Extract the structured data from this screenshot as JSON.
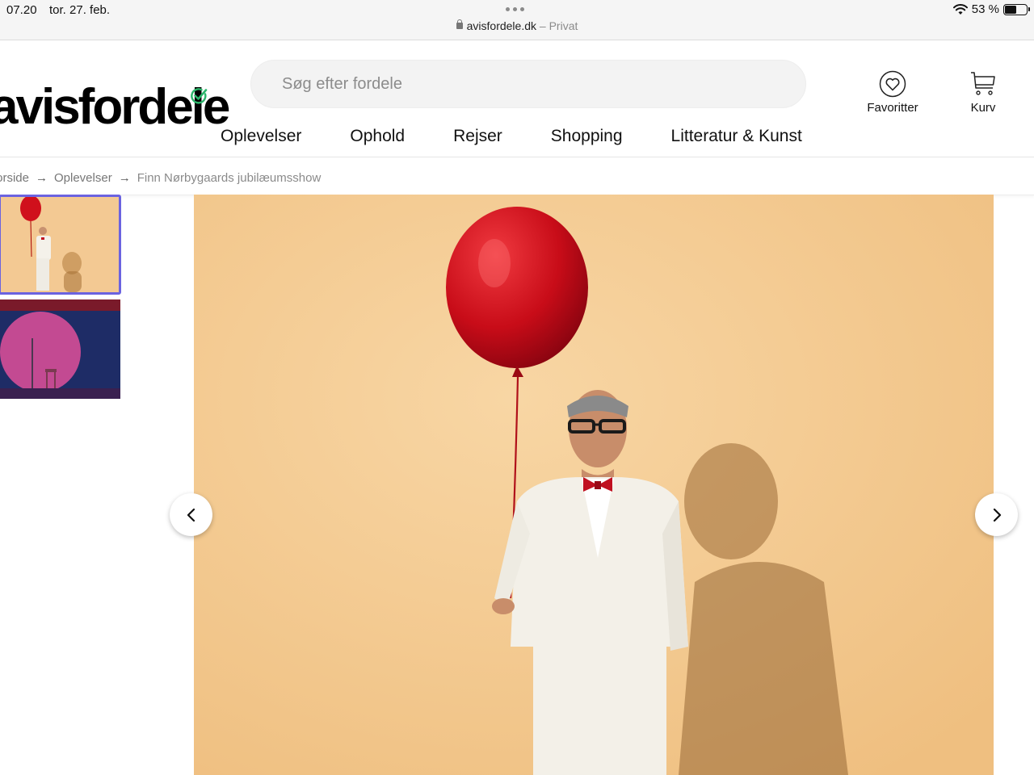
{
  "status_bar": {
    "time": "07.20",
    "date": "tor. 27. feb.",
    "battery": "53 %",
    "battery_level": 0.53
  },
  "browser": {
    "domain": "avisfordele.dk",
    "mode": "– Privat"
  },
  "header": {
    "logo": "avisfordele",
    "search_placeholder": "Søg efter fordele",
    "favorites_label": "Favoritter",
    "cart_label": "Kurv"
  },
  "nav": {
    "items": [
      "Oplevelser",
      "Ophold",
      "Rejser",
      "Shopping",
      "Litteratur & Kunst"
    ]
  },
  "breadcrumb": {
    "home": "Forside",
    "category": "Oplevelser",
    "current": "Finn Nørbygaards jubilæumsshow"
  },
  "colors": {
    "accent_check": "#2bb56a",
    "thumb_border": "#6b63e0",
    "image_background": "#f5c890",
    "balloon": "#d0101c"
  },
  "icons": {
    "favorites": "heart-icon",
    "cart": "cart-icon",
    "prev": "chevron-left-icon",
    "next": "chevron-right-icon"
  }
}
